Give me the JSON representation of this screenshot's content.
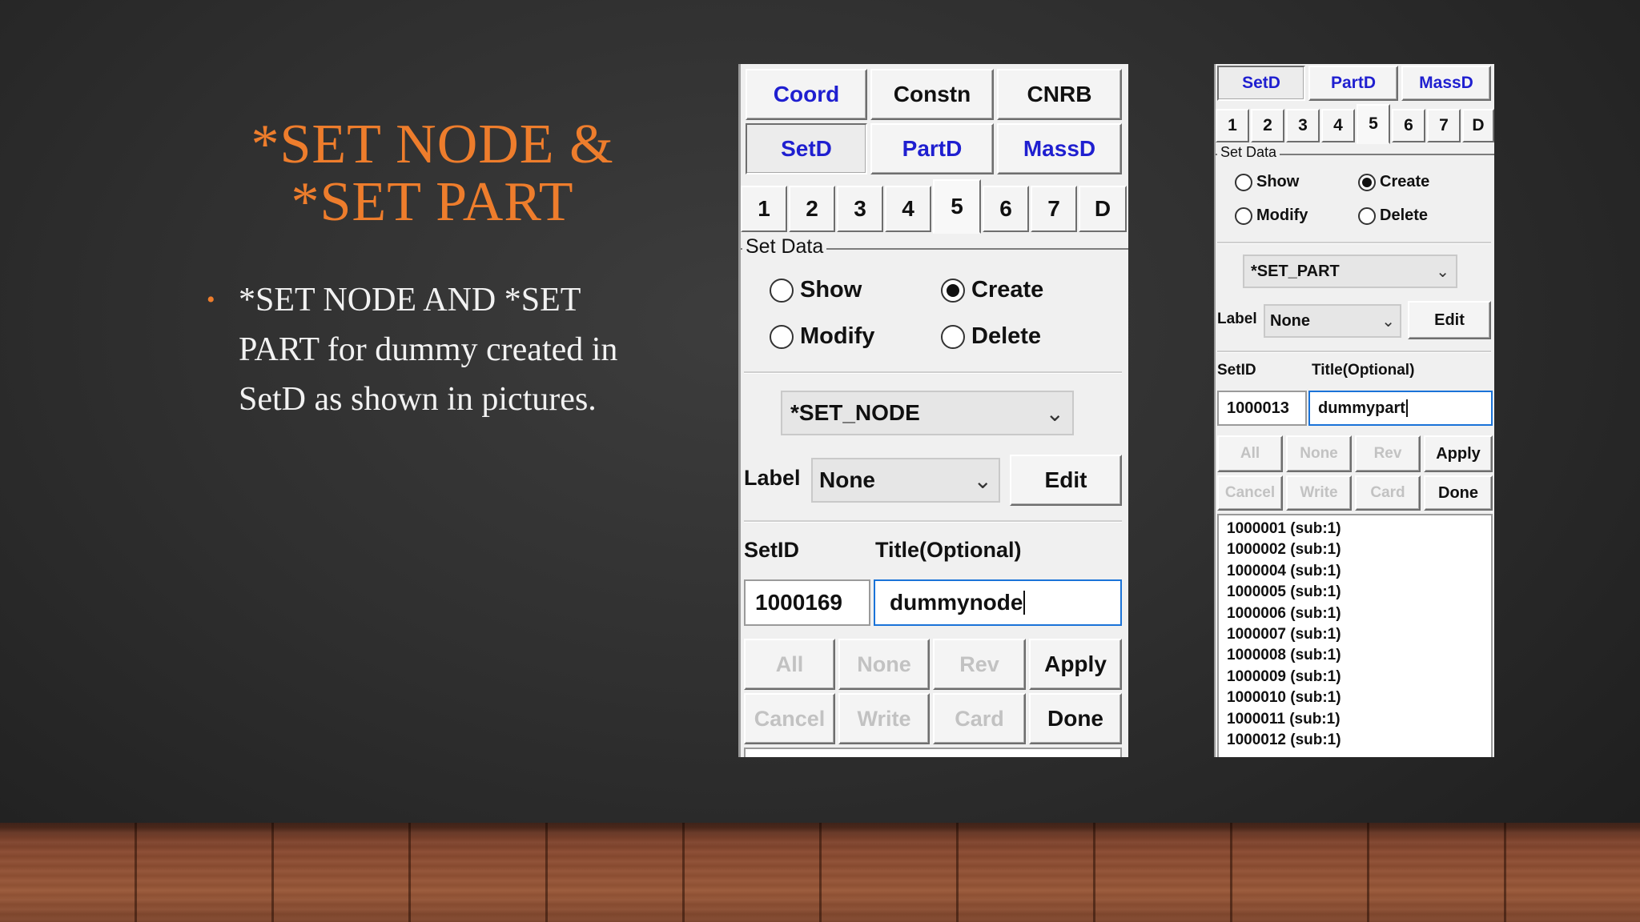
{
  "slide": {
    "title_line1": "*SET NODE &",
    "title_line2": "*SET PART",
    "bullet_text": "*SET NODE AND *SET PART for dummy created in SetD as shown in pictures.",
    "accent_color": "#ee7d2c"
  },
  "panel1": {
    "row1": [
      "Coord",
      "Constn",
      "CNRB"
    ],
    "row2": [
      "SetD",
      "PartD",
      "MassD"
    ],
    "tabs": [
      "1",
      "2",
      "3",
      "4",
      "5",
      "6",
      "7",
      "D"
    ],
    "selected_tab": "5",
    "group_label": "Set Data",
    "radio_show": "Show",
    "radio_create": "Create",
    "radio_modify": "Modify",
    "radio_delete": "Delete",
    "selected_radio": "Create",
    "keyword_select": "*SET_NODE",
    "label_caption": "Label",
    "label_value": "None",
    "edit_button": "Edit",
    "setid_caption": "SetID",
    "title_caption": "Title(Optional)",
    "setid_value": "1000169",
    "title_value": "dummynode",
    "btn_all": "All",
    "btn_none": "None",
    "btn_rev": "Rev",
    "btn_apply": "Apply",
    "btn_cancel": "Cancel",
    "btn_write": "Write",
    "btn_card": "Card",
    "btn_done": "Done"
  },
  "panel2": {
    "row1": [
      "SetD",
      "PartD",
      "MassD"
    ],
    "tabs": [
      "1",
      "2",
      "3",
      "4",
      "5",
      "6",
      "7",
      "D"
    ],
    "selected_tab": "5",
    "group_label": "Set Data",
    "radio_show": "Show",
    "radio_create": "Create",
    "radio_modify": "Modify",
    "radio_delete": "Delete",
    "selected_radio": "Create",
    "keyword_select": "*SET_PART",
    "label_caption": "Label",
    "label_value": "None",
    "edit_button": "Edit",
    "setid_caption": "SetID",
    "title_caption": "Title(Optional)",
    "setid_value": "1000013",
    "title_value": "dummypart",
    "btn_all": "All",
    "btn_none": "None",
    "btn_rev": "Rev",
    "btn_apply": "Apply",
    "btn_cancel": "Cancel",
    "btn_write": "Write",
    "btn_card": "Card",
    "btn_done": "Done",
    "list_items": [
      "1000001 (sub:1)",
      "1000002 (sub:1)",
      "1000004 (sub:1)",
      "1000005 (sub:1)",
      "1000006 (sub:1)",
      "1000007 (sub:1)",
      "1000008 (sub:1)",
      "1000009 (sub:1)",
      "1000010 (sub:1)",
      "1000011 (sub:1)",
      "1000012 (sub:1)"
    ]
  }
}
